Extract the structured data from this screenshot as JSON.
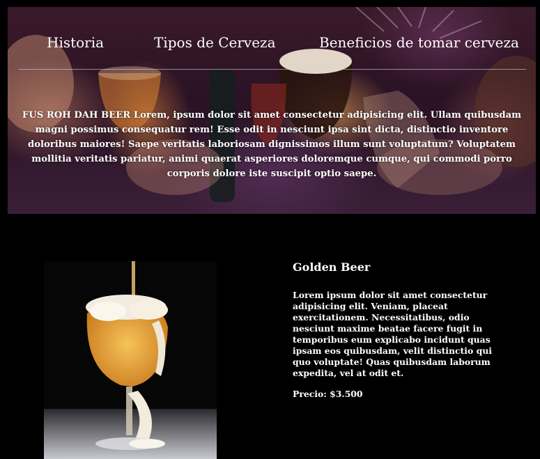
{
  "nav": {
    "items": [
      {
        "label": "Historia"
      },
      {
        "label": "Tipos de Cerveza"
      },
      {
        "label": "Beneficios de tomar cerveza"
      }
    ]
  },
  "hero": {
    "intro_text": "FUS ROH DAH BEER Lorem, ipsum dolor sit amet consectetur adipisicing elit. Ullam quibusdam magni possimus consequatur rem! Esse odit in nesciunt ipsa sint dicta, distinctio inventore doloribus maiores! Saepe veritatis laboriosam dignissimos illum sunt voluptatum? Voluptatem mollitia veritatis pariatur, animi quaerat asperiores doloremque cumque, qui commodi porro corporis dolore iste suscipit optio saepe."
  },
  "product": {
    "title": "Golden Beer",
    "description": "Lorem ipsum dolor sit amet consectetur adipisicing elit. Veniam, placeat exercitationem. Necessitatibus, odio nesciunt maxime beatae facere fugit in temporibus eum explicabo incidunt quas ipsam eos quibusdam, velit distinctio qui quo voluptate! Quas quibusdam laborum expedita, vel at odit et.",
    "price": "Precio: $3.500"
  },
  "colors": {
    "page_background": "#000000",
    "text": "#ffffff",
    "beer": "#e9a23b"
  }
}
